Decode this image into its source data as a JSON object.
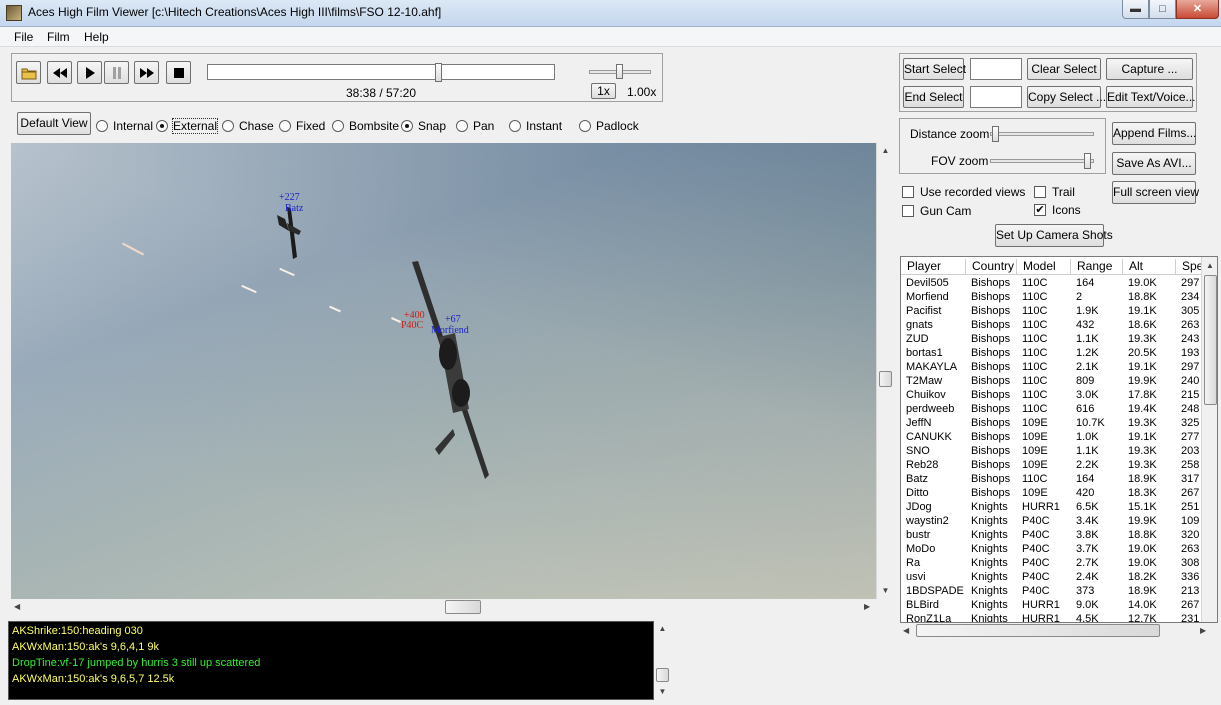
{
  "window": {
    "title": "Aces High Film Viewer [c:\\Hitech Creations\\Aces High III\\films\\FSO 12-10.ahf]"
  },
  "menu": [
    "File",
    "Film",
    "Help"
  ],
  "playback": {
    "time": "38:38 / 57:20",
    "speed_button": "1x",
    "speed_value": "1.00x",
    "progress_fraction": 0.67,
    "speed_slider_fraction": 0.5
  },
  "views": {
    "default_view_label": "Default View",
    "options": [
      {
        "label": "Internal",
        "selected": false
      },
      {
        "label": "External",
        "selected": true
      },
      {
        "label": "Chase",
        "selected": false
      },
      {
        "label": "Fixed",
        "selected": false
      },
      {
        "label": "Bombsite",
        "selected": false
      },
      {
        "label": "Snap",
        "selected": true
      },
      {
        "label": "Pan",
        "selected": false
      },
      {
        "label": "Instant",
        "selected": false
      },
      {
        "label": "Padlock",
        "selected": false
      }
    ]
  },
  "selection": {
    "start_select": "Start Select",
    "end_select": "End Select",
    "clear_select": "Clear Select",
    "copy_select": "Copy Select ...",
    "capture": "Capture ...",
    "edit_text_voice": "Edit Text/Voice...",
    "start_value": "",
    "end_value": ""
  },
  "zoom": {
    "distance_label": "Distance zoom",
    "fov_label": "FOV zoom",
    "distance_fraction": 0.02,
    "fov_fraction": 0.98,
    "append_films": "Append Films...",
    "save_as_avi": "Save As AVI..."
  },
  "options": {
    "use_recorded_views": {
      "label": "Use recorded views",
      "checked": false
    },
    "trail": {
      "label": "Trail",
      "checked": false
    },
    "gun_cam": {
      "label": "Gun Cam",
      "checked": false
    },
    "icons": {
      "label": "Icons",
      "checked": true
    },
    "full_screen_view": "Full screen view",
    "set_up_camera_shots": "Set Up Camera Shots"
  },
  "viewport": {
    "label_far_alt": "+227",
    "label_far_name": "Batz",
    "label_near_alt": "+400",
    "label_near_type": "P40C",
    "label_near2_alt": "+67",
    "label_near2_name": "Morfiend"
  },
  "chat": [
    {
      "text": "AKShrike:150:heading 030",
      "color": "#ffff66"
    },
    {
      "text": "AKWxMan:150:ak's 9,6,4,1  9k",
      "color": "#ffff66"
    },
    {
      "text": "DropTine:vf-17 jumped by hurris  3 still up  scattered",
      "color": "#33ee33"
    },
    {
      "text": "AKWxMan:150:ak's 9,6,5,7 12.5k",
      "color": "#ffff66"
    }
  ],
  "table": {
    "columns": [
      "Player",
      "Country",
      "Model",
      "Range",
      "Alt",
      "Spe"
    ],
    "rows": [
      [
        "Devil505",
        "Bishops",
        "110C",
        "164",
        "19.0K",
        "297"
      ],
      [
        "Morfiend",
        "Bishops",
        "110C",
        "2",
        "18.8K",
        "234"
      ],
      [
        "Pacifist",
        "Bishops",
        "110C",
        "1.9K",
        "19.1K",
        "305"
      ],
      [
        "gnats",
        "Bishops",
        "110C",
        "432",
        "18.6K",
        "263"
      ],
      [
        "ZUD",
        "Bishops",
        "110C",
        "1.1K",
        "19.3K",
        "243"
      ],
      [
        "bortas1",
        "Bishops",
        "110C",
        "1.2K",
        "20.5K",
        "193"
      ],
      [
        "MAKAYLA",
        "Bishops",
        "110C",
        "2.1K",
        "19.1K",
        "297"
      ],
      [
        "T2Maw",
        "Bishops",
        "110C",
        "809",
        "19.9K",
        "240"
      ],
      [
        "Chuikov",
        "Bishops",
        "110C",
        "3.0K",
        "17.8K",
        "215"
      ],
      [
        "perdweeb",
        "Bishops",
        "110C",
        "616",
        "19.4K",
        "248"
      ],
      [
        "JeffN",
        "Bishops",
        "109E",
        "10.7K",
        "19.3K",
        "325"
      ],
      [
        "CANUKK",
        "Bishops",
        "109E",
        "1.0K",
        "19.1K",
        "277"
      ],
      [
        "SNO",
        "Bishops",
        "109E",
        "1.1K",
        "19.3K",
        "203"
      ],
      [
        "Reb28",
        "Bishops",
        "109E",
        "2.2K",
        "19.3K",
        "258"
      ],
      [
        "Batz",
        "Bishops",
        "110C",
        "164",
        "18.9K",
        "317"
      ],
      [
        "Ditto",
        "Bishops",
        "109E",
        "420",
        "18.3K",
        "267"
      ],
      [
        "JDog",
        "Knights",
        "HURR1",
        "6.5K",
        "15.1K",
        "251"
      ],
      [
        "waystin2",
        "Knights",
        "P40C",
        "3.4K",
        "19.9K",
        "109"
      ],
      [
        "bustr",
        "Knights",
        "P40C",
        "3.8K",
        "18.8K",
        "320"
      ],
      [
        "MoDo",
        "Knights",
        "P40C",
        "3.7K",
        "19.0K",
        "263"
      ],
      [
        "Ra",
        "Knights",
        "P40C",
        "2.7K",
        "19.0K",
        "308"
      ],
      [
        "usvi",
        "Knights",
        "P40C",
        "2.4K",
        "18.2K",
        "336"
      ],
      [
        "1BDSPADE",
        "Knights",
        "P40C",
        "373",
        "18.9K",
        "213"
      ],
      [
        "BLBird",
        "Knights",
        "HURR1",
        "9.0K",
        "14.0K",
        "267"
      ],
      [
        "RonZ1La",
        "Knights",
        "HURR1",
        "4.5K",
        "12.7K",
        "231"
      ]
    ]
  }
}
